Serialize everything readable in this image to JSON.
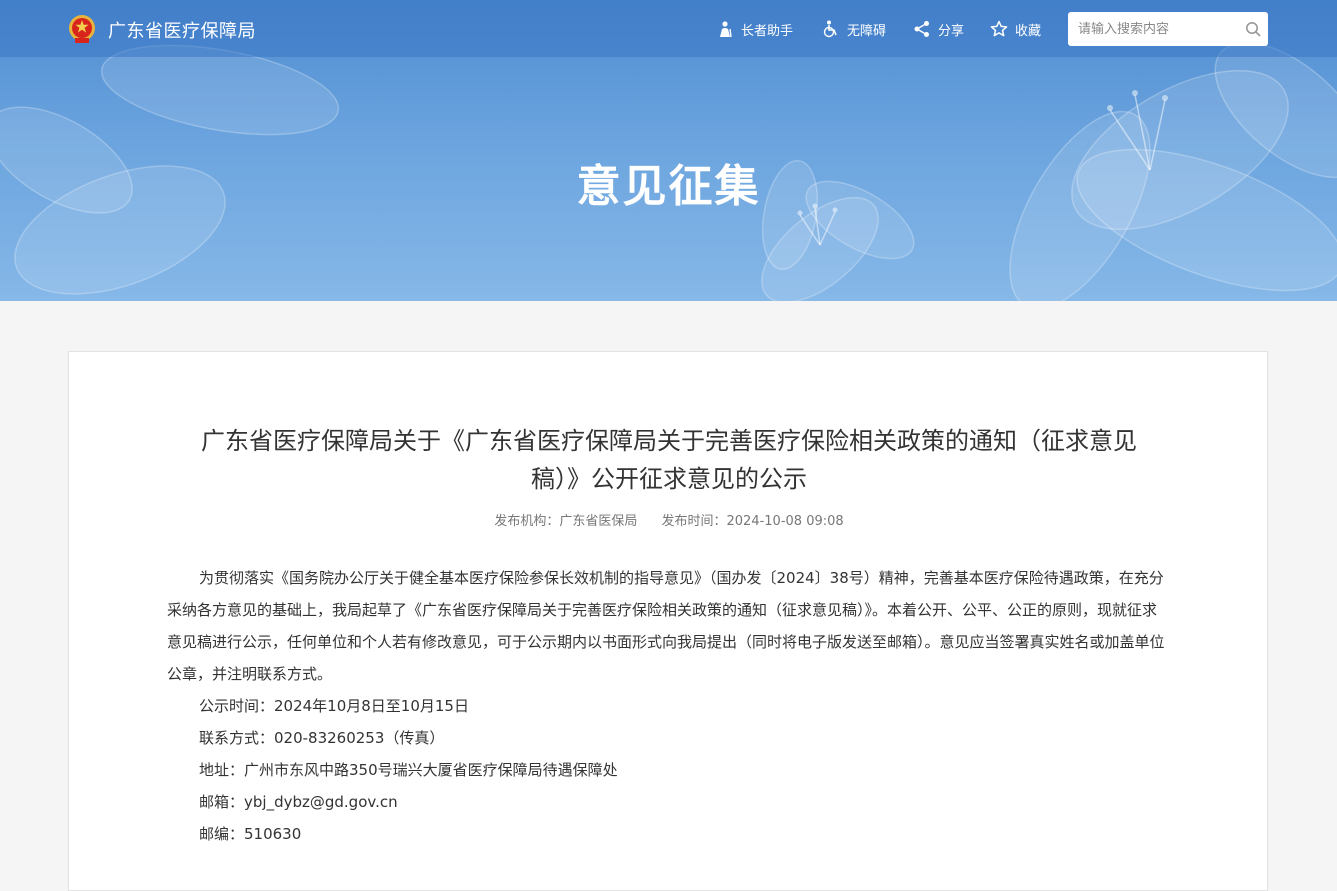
{
  "site": {
    "name": "广东省医疗保障局"
  },
  "nav": {
    "elder": "长者助手",
    "accessibility": "无障碍",
    "share": "分享",
    "favorite": "收藏"
  },
  "search": {
    "placeholder": "请输入搜索内容"
  },
  "banner": {
    "title": "意见征集"
  },
  "article": {
    "title_line1": "广东省医疗保障局关于《广东省医疗保障局关于完善医疗保险相关政策的通知（征求意见",
    "title_line2": "稿）》公开征求意见的公示",
    "publisher_label": "发布机构：",
    "publisher": "广东省医保局",
    "time_label": "发布时间：",
    "time": "2024-10-08 09:08",
    "paragraph": "为贯彻落实《国务院办公厅关于健全基本医疗保险参保长效机制的指导意见》（国办发〔2024〕38号）精神，完善基本医疗保险待遇政策，在充分采纳各方意见的基础上，我局起草了《广东省医疗保障局关于完善医疗保险相关政策的通知（征求意见稿）》。本着公开、公平、公正的原则，现就征求意见稿进行公示，任何单位和个人若有修改意见，可于公示期内以书面形式向我局提出（同时将电子版发送至邮箱）。意见应当签署真实姓名或加盖单位公章，并注明联系方式。",
    "notice_period": "公示时间：2024年10月8日至10月15日",
    "contact": "联系方式：020-83260253（传真）",
    "address": "地址：广州市东风中路350号瑞兴大厦省医疗保障局待遇保障处",
    "email": "邮箱：ybj_dybz@gd.gov.cn",
    "postcode": "邮编：510630"
  },
  "colors": {
    "banner": "#5a97d6",
    "topbar": "#3f7cc6",
    "text": "#333333",
    "meta": "#777777"
  },
  "icons": {
    "logo": "national-emblem-icon",
    "elder": "elder-person-icon",
    "accessibility": "wheelchair-icon",
    "share": "share-icon",
    "favorite": "star-icon",
    "search": "search-icon"
  }
}
